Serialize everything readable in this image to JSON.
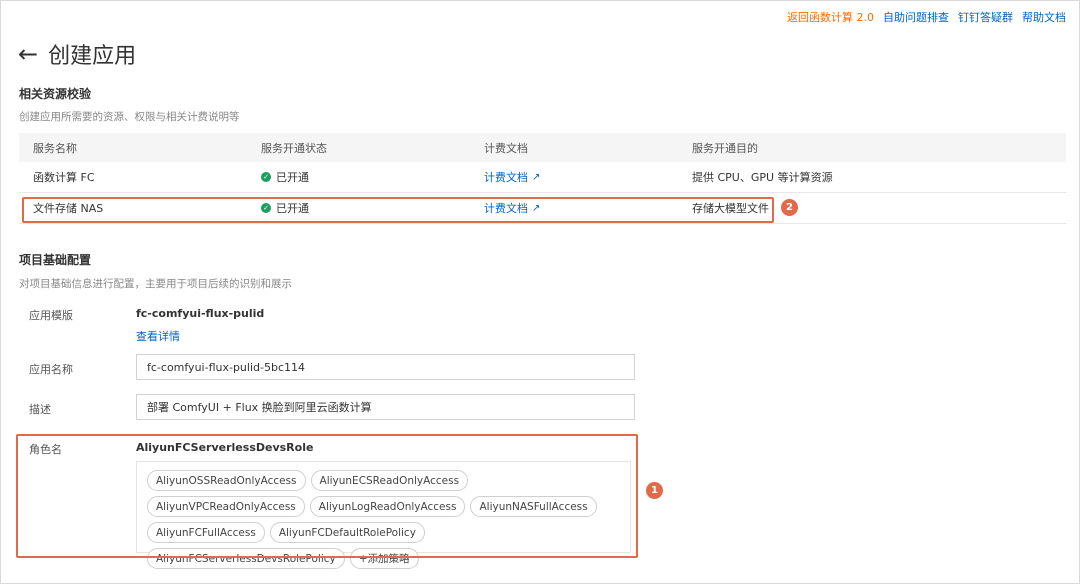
{
  "header": {
    "links": [
      "返回函数计算 2.0",
      "自助问题排查",
      "钉钉答疑群",
      "帮助文档"
    ],
    "back_icon": "arrow-left-icon",
    "title": "创建应用"
  },
  "resource_section": {
    "title": "相关资源校验",
    "description": "创建应用所需要的资源、权限与相关计费说明等",
    "columns": [
      "服务名称",
      "服务开通状态",
      "计费文档",
      "服务开通目的"
    ],
    "rows": [
      {
        "name": "函数计算 FC",
        "status": "已开通",
        "doc": "计费文档",
        "purpose": "提供 CPU、GPU 等计算资源"
      },
      {
        "name": "文件存储 NAS",
        "status": "已开通",
        "doc": "计费文档",
        "purpose": "存储大模型文件"
      }
    ],
    "status_icon": "check-circle-icon",
    "link_icon": "external-link-icon"
  },
  "config_section": {
    "title": "项目基础配置",
    "description": "对项目基础信息进行配置，主要用于项目后续的识别和展示",
    "template_label": "应用模版",
    "template_value": "fc-comfyui-flux-pulid",
    "template_link": "查看详情",
    "app_name_label": "应用名称",
    "app_name_value": "fc-comfyui-flux-pulid-5bc114",
    "desc_label": "描述",
    "desc_value": "部署 ComfyUI + Flux 换脸到阿里云函数计算",
    "role_label": "角色名",
    "role_value": "AliyunFCServerlessDevsRole",
    "policies": [
      "AliyunOSSReadOnlyAccess",
      "AliyunECSReadOnlyAccess",
      "AliyunVPCReadOnlyAccess",
      "AliyunLogReadOnlyAccess",
      "AliyunNASFullAccess",
      "AliyunFCFullAccess",
      "AliyunFCDefaultRolePolicy",
      "AliyunFCServerlessDevsRolePolicy"
    ],
    "add_policy": "+添加策略"
  },
  "annotations": {
    "badge_1": "1",
    "badge_2": "2",
    "highlight_color": "#e06a4a"
  },
  "colors": {
    "link": "#0064c8",
    "accent": "#ff6a00",
    "success": "#1a9f5c"
  }
}
